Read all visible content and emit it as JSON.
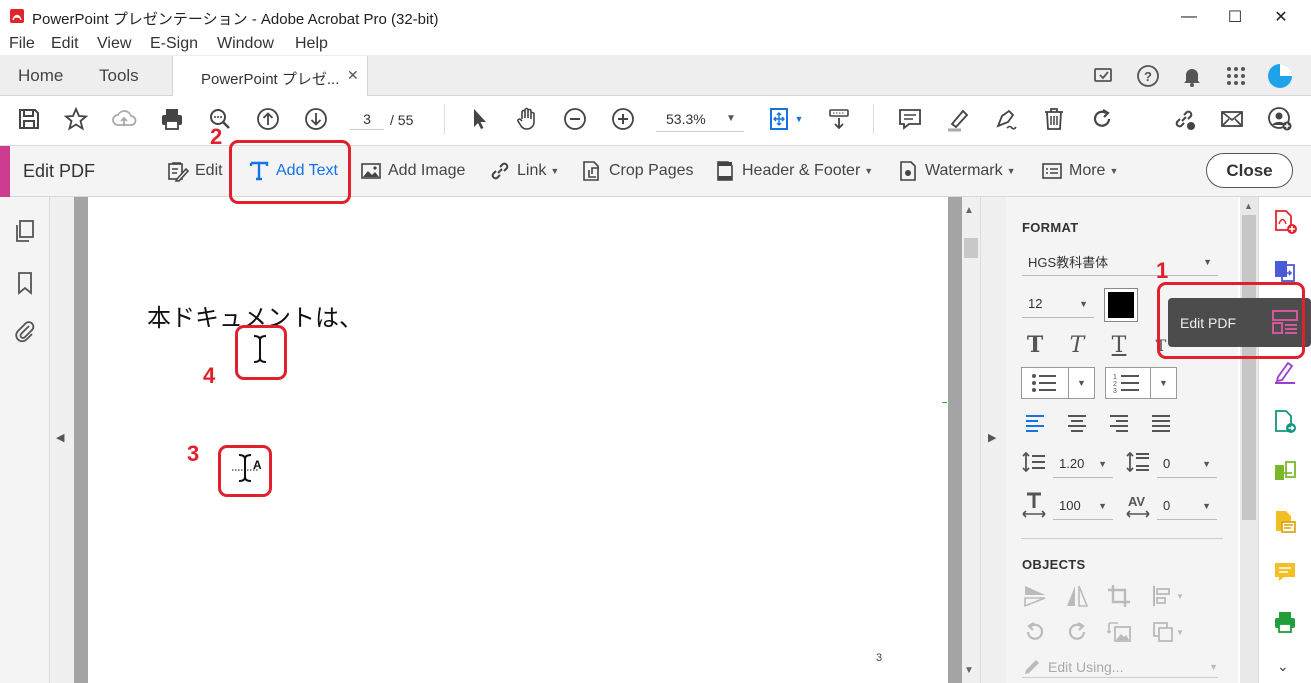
{
  "window": {
    "title": "PowerPoint プレゼンテーション - Adobe Acrobat Pro (32-bit)",
    "minimize": "—",
    "maximize": "☐",
    "close": "✕"
  },
  "menu": [
    "File",
    "Edit",
    "View",
    "E-Sign",
    "Window",
    "Help"
  ],
  "tabs": {
    "home": "Home",
    "tools": "Tools",
    "document": "PowerPoint プレゼ...",
    "document_close": "✕"
  },
  "toolbar": {
    "current_page": "3",
    "page_total": "/ 55",
    "zoom": "53.3%"
  },
  "editbar": {
    "title": "Edit PDF",
    "edit": "Edit",
    "add_text": "Add Text",
    "add_image": "Add Image",
    "link": "Link",
    "crop_pages": "Crop Pages",
    "header_footer": "Header & Footer",
    "watermark": "Watermark",
    "more": "More",
    "close": "Close"
  },
  "document": {
    "text": "本ドキュメントは、",
    "page_number": "3"
  },
  "format_panel": {
    "format_heading": "FORMAT",
    "font_name": "HGS教科書体",
    "font_size": "12",
    "text_color": "#000000",
    "line_spacing": "1.20",
    "paragraph_spacing": "0",
    "horizontal_scaling": "100",
    "char_spacing": "0",
    "objects_heading": "OBJECTS",
    "edit_using": "Edit Using..."
  },
  "tooltip": {
    "label": "Edit PDF"
  },
  "annotations": {
    "label_1": "1",
    "label_2": "2",
    "label_3": "3",
    "label_4": "4"
  },
  "colors": {
    "accent_edit_pdf": "#cc3d8f",
    "add_text_blue": "#1473e6",
    "annotation_red": "#e0202c"
  }
}
